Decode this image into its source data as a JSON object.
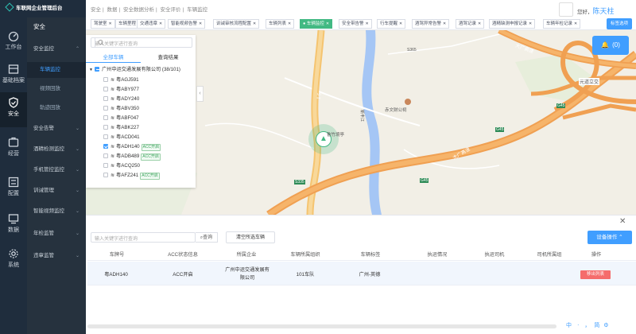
{
  "brand": {
    "title": "车联网企业管理后台"
  },
  "breadcrumb": [
    "安全",
    "数据",
    "安全数据分析",
    "安全评价",
    "车辆监控"
  ],
  "user": {
    "greeting": "您好，",
    "name": "陈天柱"
  },
  "rail": [
    {
      "label": "工作台",
      "icon": "dashboard-icon"
    },
    {
      "label": "基础档案",
      "icon": "archive-icon"
    },
    {
      "label": "安全",
      "icon": "shield-icon"
    },
    {
      "label": "经营",
      "icon": "business-icon"
    },
    {
      "label": "配置",
      "icon": "config-icon"
    },
    {
      "label": "数据",
      "icon": "data-icon"
    },
    {
      "label": "系统",
      "icon": "gear-icon"
    }
  ],
  "submenu": {
    "header": "安全",
    "items": [
      {
        "label": "安全监控",
        "type": "group",
        "expanded": true
      },
      {
        "label": "车辆监控",
        "type": "child",
        "active": true
      },
      {
        "label": "视频回放",
        "type": "child"
      },
      {
        "label": "轨迹回放",
        "type": "child"
      },
      {
        "label": "安全告警",
        "type": "group"
      },
      {
        "label": "酒精检测监控",
        "type": "group"
      },
      {
        "label": "手机管控监控",
        "type": "group"
      },
      {
        "label": "训诫管理",
        "type": "group"
      },
      {
        "label": "智能视频监控",
        "type": "group"
      },
      {
        "label": "年检监管",
        "type": "group"
      },
      {
        "label": "违章监管",
        "type": "group"
      }
    ]
  },
  "tabs": [
    "驾驶室",
    "车辆里程",
    "交通违章",
    "智能视频告警",
    "训诫审核流程配置",
    "车辆列表",
    "车辆监控",
    "安全带告警",
    "行车提醒",
    "酒驾异常告警",
    "酒驾记录",
    "酒精缺测申报记录",
    "车辆年检记录"
  ],
  "active_tab": "车辆监控",
  "tab_menu": "标签选项",
  "notifications": {
    "count": "(0)"
  },
  "map_labels": {
    "town": "鲁竹境亭",
    "poi": "赤文财公祠",
    "road1": "G45",
    "road2": "G45",
    "road3": "G45",
    "road4": "G45",
    "interchange": "元道立交",
    "road_name": "大广高速",
    "left_road": "1 5",
    "county": "新丰江",
    "s": "S365",
    "num": "S335"
  },
  "vehicle_panel": {
    "search_placeholder": "输入关键字进行查询",
    "tabs": [
      "全部车辆",
      "查询结果"
    ],
    "company": "广州中运交通发展有限公司 (38/101)",
    "vehicles": [
      {
        "plate": "粤AGJ591",
        "checked": false,
        "acc": ""
      },
      {
        "plate": "粤ABY977",
        "checked": false,
        "acc": ""
      },
      {
        "plate": "粤ADY240",
        "checked": false,
        "acc": ""
      },
      {
        "plate": "粤ABV350",
        "checked": false,
        "acc": ""
      },
      {
        "plate": "粤ABF047",
        "checked": false,
        "acc": ""
      },
      {
        "plate": "粤ABK227",
        "checked": false,
        "acc": ""
      },
      {
        "plate": "粤ACD041",
        "checked": false,
        "acc": ""
      },
      {
        "plate": "粤ADH140",
        "checked": true,
        "acc": "ACC开启"
      },
      {
        "plate": "粤ADB489",
        "checked": false,
        "acc": "ACC开启"
      },
      {
        "plate": "粤ACQ250",
        "checked": false,
        "acc": ""
      },
      {
        "plate": "粤AFZ241",
        "checked": false,
        "acc": "ACC开启"
      }
    ]
  },
  "bottom": {
    "search_placeholder": "输入关键字进行查询",
    "query": "查询",
    "clear": "清空所选车辆",
    "ops": "设备操作 ⌃",
    "close": "✕",
    "columns": [
      "车牌号",
      "ACC状态信息",
      "所属企业",
      "车辆所属组织",
      "车辆标签",
      "执运情况",
      "执运司机",
      "司机所属组",
      "操作"
    ],
    "row": {
      "plate": "粤ADH140",
      "acc": "ACC开启",
      "company1": "广州中运交通发展有",
      "company2": "限公司",
      "org": "101车队",
      "tag": "广州-英德",
      "run": "",
      "driver": "",
      "group": ""
    },
    "remove": "移出列表"
  },
  "tray": [
    "中",
    "ㆍ",
    "，",
    "简",
    "⚙"
  ]
}
